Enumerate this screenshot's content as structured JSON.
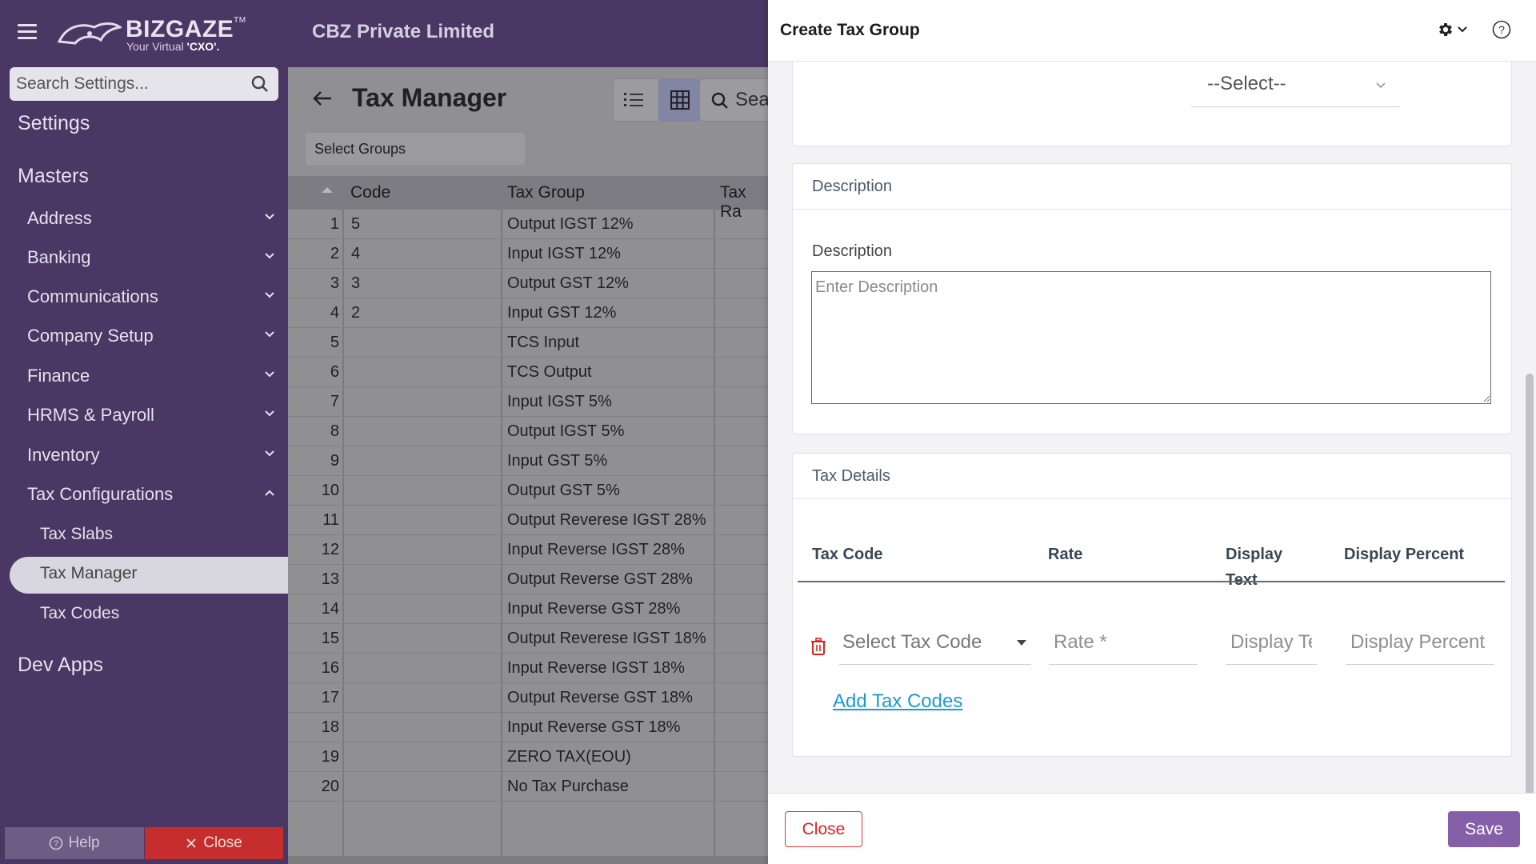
{
  "topbar": {
    "logo_name": "BIZGAZE",
    "logo_tm": "TM",
    "logo_tag_prefix": "Your Virtual ",
    "logo_tag_bold": "'CXO'.",
    "company": "CBZ Private Limited"
  },
  "sidebar": {
    "search_placeholder": "Search Settings...",
    "groups": {
      "settings": "Settings",
      "masters": "Masters",
      "dev_apps": "Dev Apps"
    },
    "items": [
      "Address",
      "Banking",
      "Communications",
      "Company Setup",
      "Finance",
      "HRMS & Payroll",
      "Inventory",
      "Tax Configurations"
    ],
    "sub_items": [
      "Tax Slabs",
      "Tax Manager",
      "Tax Codes"
    ],
    "help": "Help",
    "close": "Close"
  },
  "main": {
    "title": "Tax Manager",
    "search_partial": "Sea",
    "select_groups": "Select Groups",
    "columns": [
      "Code",
      "Tax Group",
      "Tax Ra"
    ],
    "rows": [
      {
        "n": "1",
        "code": "5",
        "group": "Output IGST 12%"
      },
      {
        "n": "2",
        "code": "4",
        "group": "Input IGST 12%"
      },
      {
        "n": "3",
        "code": "3",
        "group": "Output GST 12%"
      },
      {
        "n": "4",
        "code": "2",
        "group": "Input GST 12%"
      },
      {
        "n": "5",
        "code": "",
        "group": "TCS Input"
      },
      {
        "n": "6",
        "code": "",
        "group": "TCS Output"
      },
      {
        "n": "7",
        "code": "",
        "group": "Input IGST 5%"
      },
      {
        "n": "8",
        "code": "",
        "group": "Output IGST 5%"
      },
      {
        "n": "9",
        "code": "",
        "group": "Input GST 5%"
      },
      {
        "n": "10",
        "code": "",
        "group": "Output GST 5%"
      },
      {
        "n": "11",
        "code": "",
        "group": "Output Reverese IGST 28%"
      },
      {
        "n": "12",
        "code": "",
        "group": "Input Reverse IGST 28%"
      },
      {
        "n": "13",
        "code": "",
        "group": "Output Reverse GST 28%"
      },
      {
        "n": "14",
        "code": "",
        "group": "Input Reverse GST 28%"
      },
      {
        "n": "15",
        "code": "",
        "group": "Output Reverese IGST 18%"
      },
      {
        "n": "16",
        "code": "",
        "group": "Input Reverse IGST 18%"
      },
      {
        "n": "17",
        "code": "",
        "group": "Output Reverse GST 18%"
      },
      {
        "n": "18",
        "code": "",
        "group": "Input Reverse GST 18%"
      },
      {
        "n": "19",
        "code": "",
        "group": "ZERO TAX(EOU)"
      },
      {
        "n": "20",
        "code": "",
        "group": "No Tax Purchase"
      }
    ]
  },
  "drawer": {
    "title": "Create Tax Group",
    "select_value": "--Select--",
    "description_section": "Description",
    "description_label": "Description",
    "description_placeholder": "Enter Description",
    "tax_details_section": "Tax Details",
    "columns": {
      "tax_code": "Tax Code",
      "rate": "Rate",
      "display_text_1": "Display",
      "display_text_2": "Text",
      "display_percent": "Display Percent"
    },
    "row": {
      "tax_code_placeholder": "Select Tax Code",
      "rate_placeholder": "Rate *",
      "display_text_placeholder": "Display Text",
      "display_percent_placeholder": "Display Percent"
    },
    "add_link": "Add Tax Codes",
    "close": "Close",
    "save": "Save"
  }
}
